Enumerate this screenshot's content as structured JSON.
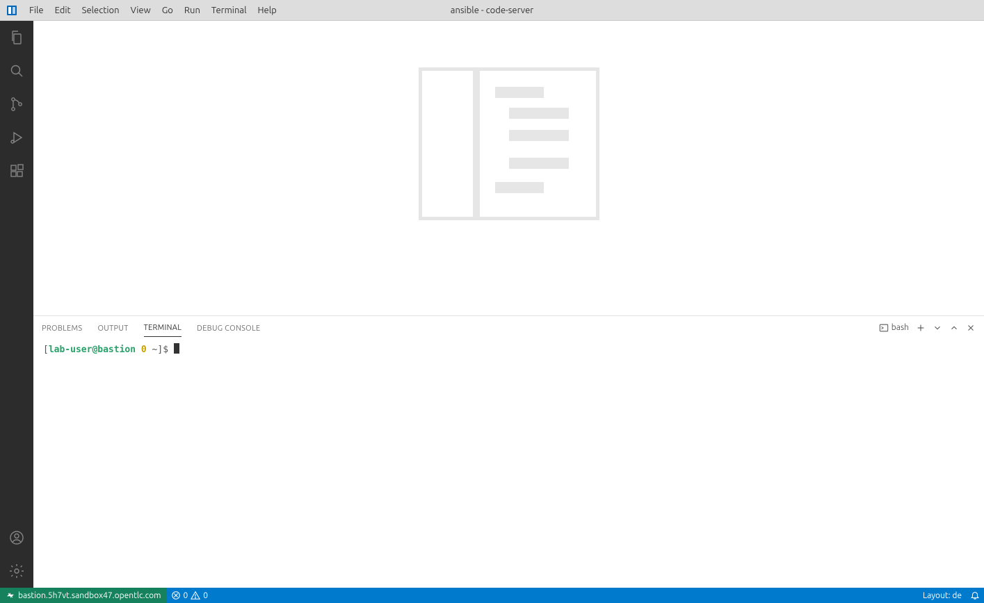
{
  "title": "ansible - code-server",
  "menu": [
    "File",
    "Edit",
    "Selection",
    "View",
    "Go",
    "Run",
    "Terminal",
    "Help"
  ],
  "panel": {
    "tabs": [
      "Problems",
      "Output",
      "Terminal",
      "Debug Console"
    ],
    "active": "Terminal",
    "shell": "bash"
  },
  "terminal": {
    "user_host": "lab-user@bastion",
    "status": "0",
    "path": "~",
    "suffix": "]$"
  },
  "status": {
    "remote": "bastion.5h7vt.sandbox47.opentlc.com",
    "errors": "0",
    "warnings": "0",
    "layout": "Layout: de"
  }
}
